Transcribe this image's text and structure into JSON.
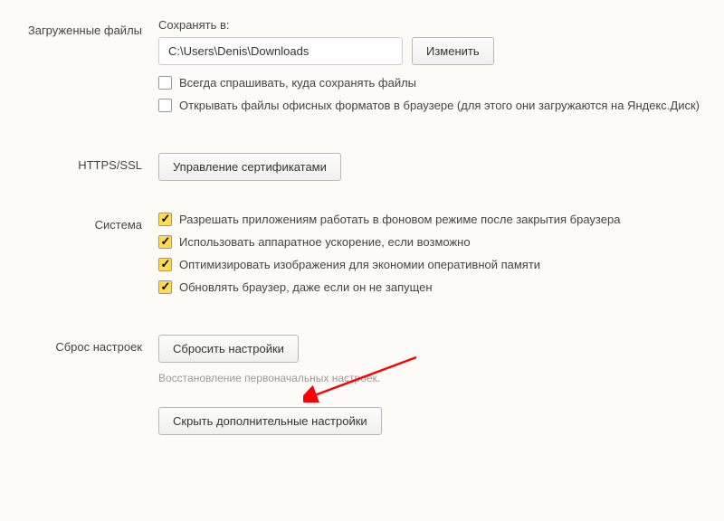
{
  "downloads": {
    "section_label": "Загруженные файлы",
    "save_to_label": "Сохранять в:",
    "path_value": "C:\\Users\\Denis\\Downloads",
    "change_button": "Изменить",
    "always_ask": "Всегда спрашивать, куда сохранять файлы",
    "open_office": "Открывать файлы офисных форматов в браузере (для этого они загружаются на Яндекс.Диск)"
  },
  "https": {
    "section_label": "HTTPS/SSL",
    "manage_certs": "Управление сертификатами"
  },
  "system": {
    "section_label": "Система",
    "allow_bg": "Разрешать приложениям работать в фоновом режиме после закрытия браузера",
    "hw_accel": "Использовать аппаратное ускорение, если возможно",
    "optimize_img": "Оптимизировать изображения для экономии оперативной памяти",
    "update_browser": "Обновлять браузер, даже если он не запущен"
  },
  "reset": {
    "section_label": "Сброс настроек",
    "reset_button": "Сбросить настройки",
    "hint": "Восстановление первоначальных настроек."
  },
  "hide_advanced": "Скрыть дополнительные настройки"
}
